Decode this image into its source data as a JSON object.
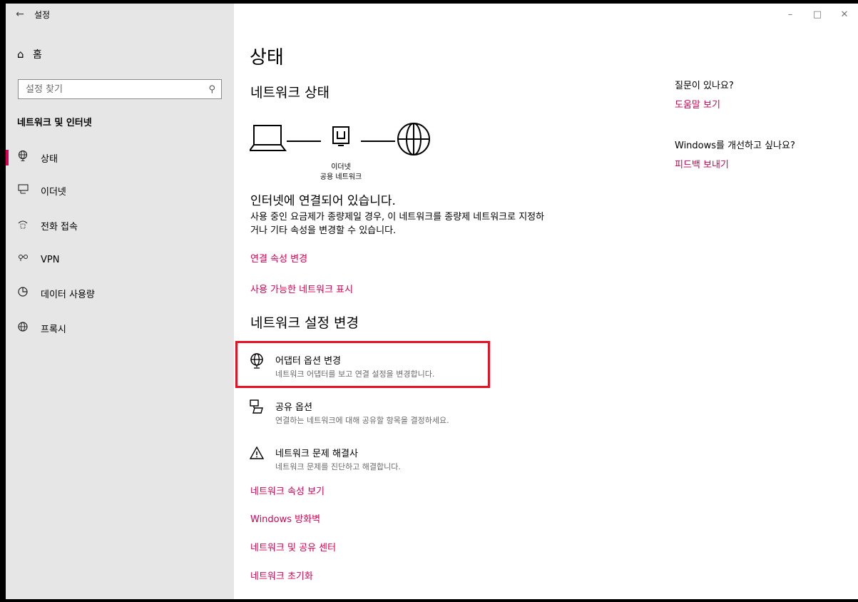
{
  "window": {
    "title": "설정",
    "back_icon": "←",
    "controls": [
      "–",
      "□",
      "✕"
    ]
  },
  "sidebar": {
    "home_label": "홈",
    "search_placeholder": "설정 찾기",
    "section_title": "네트워크 및 인터넷",
    "items": [
      {
        "label": "상태",
        "icon": "globe-monitor-icon",
        "active": true
      },
      {
        "label": "이더넷",
        "icon": "ethernet-icon",
        "active": false
      },
      {
        "label": "전화 접속",
        "icon": "dialup-icon",
        "active": false
      },
      {
        "label": "VPN",
        "icon": "vpn-icon",
        "active": false
      },
      {
        "label": "데이터 사용량",
        "icon": "data-usage-icon",
        "active": false
      },
      {
        "label": "프록시",
        "icon": "globe-icon",
        "active": false
      }
    ]
  },
  "main": {
    "title": "상태",
    "network_status_heading": "네트워크 상태",
    "diagram": {
      "adapter_label": "이더넷",
      "network_label": "공용 네트워크"
    },
    "connected_title": "인터넷에 연결되어 있습니다.",
    "connected_desc": "사용 중인 요금제가 종량제일 경우, 이 네트워크를 종량제 네트워크로 지정하거나 기타 속성을 변경할 수 있습니다.",
    "link_change_properties": "연결 속성 변경",
    "link_show_available": "사용 가능한 네트워크 표시",
    "change_settings_heading": "네트워크 설정 변경",
    "options": [
      {
        "title": "어댑터 옵션 변경",
        "desc": "네트워크 어댑터를 보고 연결 설정을 변경합니다.",
        "icon": "adapter-icon"
      },
      {
        "title": "공유 옵션",
        "desc": "연결하는 네트워크에 대해 공유할 항목을 결정하세요.",
        "icon": "sharing-icon"
      },
      {
        "title": "네트워크 문제 해결사",
        "desc": "네트워크 문제를 진단하고 해결합니다.",
        "icon": "warning-icon"
      }
    ],
    "bottom_links": [
      "네트워크 속성 보기",
      "Windows 방화벽",
      "네트워크 및 공유 센터",
      "네트워크 초기화"
    ]
  },
  "aside": {
    "question": "질문이 있나요?",
    "help_link": "도움말 보기",
    "improve": "Windows를 개선하고 싶나요?",
    "feedback_link": "피드백 보내기"
  },
  "colors": {
    "accent": "#d70052",
    "highlight": "#e81123",
    "sidebar_bg": "#e6e6e6"
  }
}
